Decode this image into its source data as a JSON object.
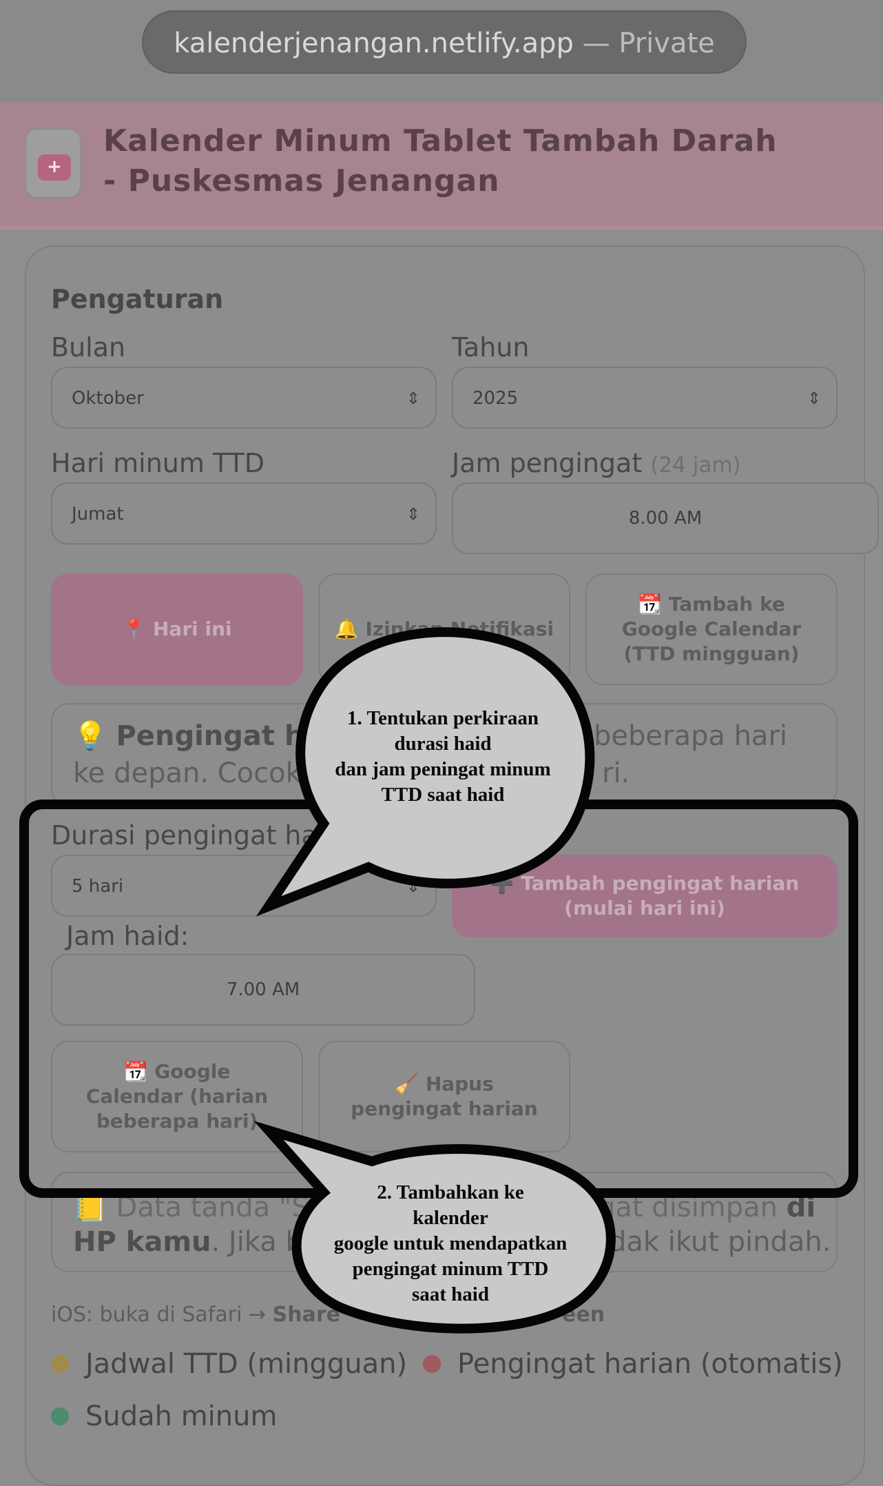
{
  "browser": {
    "url": "kalenderjenangan.netlify.app",
    "separator": " — ",
    "mode": "Private"
  },
  "header": {
    "icon": "calendar-plus-icon",
    "title": "Kalender Minum Tablet Tambah Darah - Puskesmas Jenangan"
  },
  "settings": {
    "title": "Pengaturan",
    "month": {
      "label": "Bulan",
      "value": "Oktober"
    },
    "year": {
      "label": "Tahun",
      "value": "2025"
    },
    "day": {
      "label": "Hari minum TTD",
      "value": "Jumat"
    },
    "reminder_time": {
      "label": "Jam pengingat",
      "hint": "(24 jam)",
      "value": "8.00 AM"
    }
  },
  "buttons": {
    "today": "📍 Hari ini",
    "notify": "🔔 Izinkan Notifikasi",
    "gcal_weekly": "📆 Tambah ke Google Calendar (TTD mingguan)"
  },
  "tip": {
    "icon": "💡",
    "bold": "Pengingat ha",
    "line1_right": "beberapa hari",
    "line2_left": "ke depan. Cocok",
    "line2_right": "ri."
  },
  "haid": {
    "duration_label": "Durasi pengingat ha",
    "duration_value": "5 hari",
    "add_daily_button": "➕ Tambah pengingat harian (mulai hari ini)",
    "time_label": "Jam haid:",
    "time_value": "7.00 AM",
    "gcal_daily_button": "📆 Google Calendar (harian beberapa hari)",
    "delete_button": "🧹 Hapus pengingat harian"
  },
  "note": {
    "icon": "📒",
    "line1_left": "Data tanda \"S",
    "line1_right": "gat disimpan",
    "line1_bold": "di",
    "line2_bold": "HP kamu",
    "line2_left": ". Jika b",
    "line2_right": "dak ikut pindah."
  },
  "ios": {
    "text": "iOS: buka di Safari → ",
    "bold_left": "Share",
    "bold_right": "een"
  },
  "legend": [
    {
      "label": "Jadwal TTD (mingguan)",
      "color": "#a08a4c"
    },
    {
      "label": "Pengingat harian (otomatis)",
      "color": "#a05a5e"
    },
    {
      "label": "Sudah minum",
      "color": "#4e8a6e"
    }
  ],
  "callouts": [
    {
      "text": "1. Tentukan perkiraan\ndurasi haid\ndan jam peningat minum\nTTD saat haid"
    },
    {
      "text": "2. Tambahkan ke\nkalender\ngoogle untuk mendapatkan\npengingat minum TTD\nsaat haid"
    }
  ]
}
